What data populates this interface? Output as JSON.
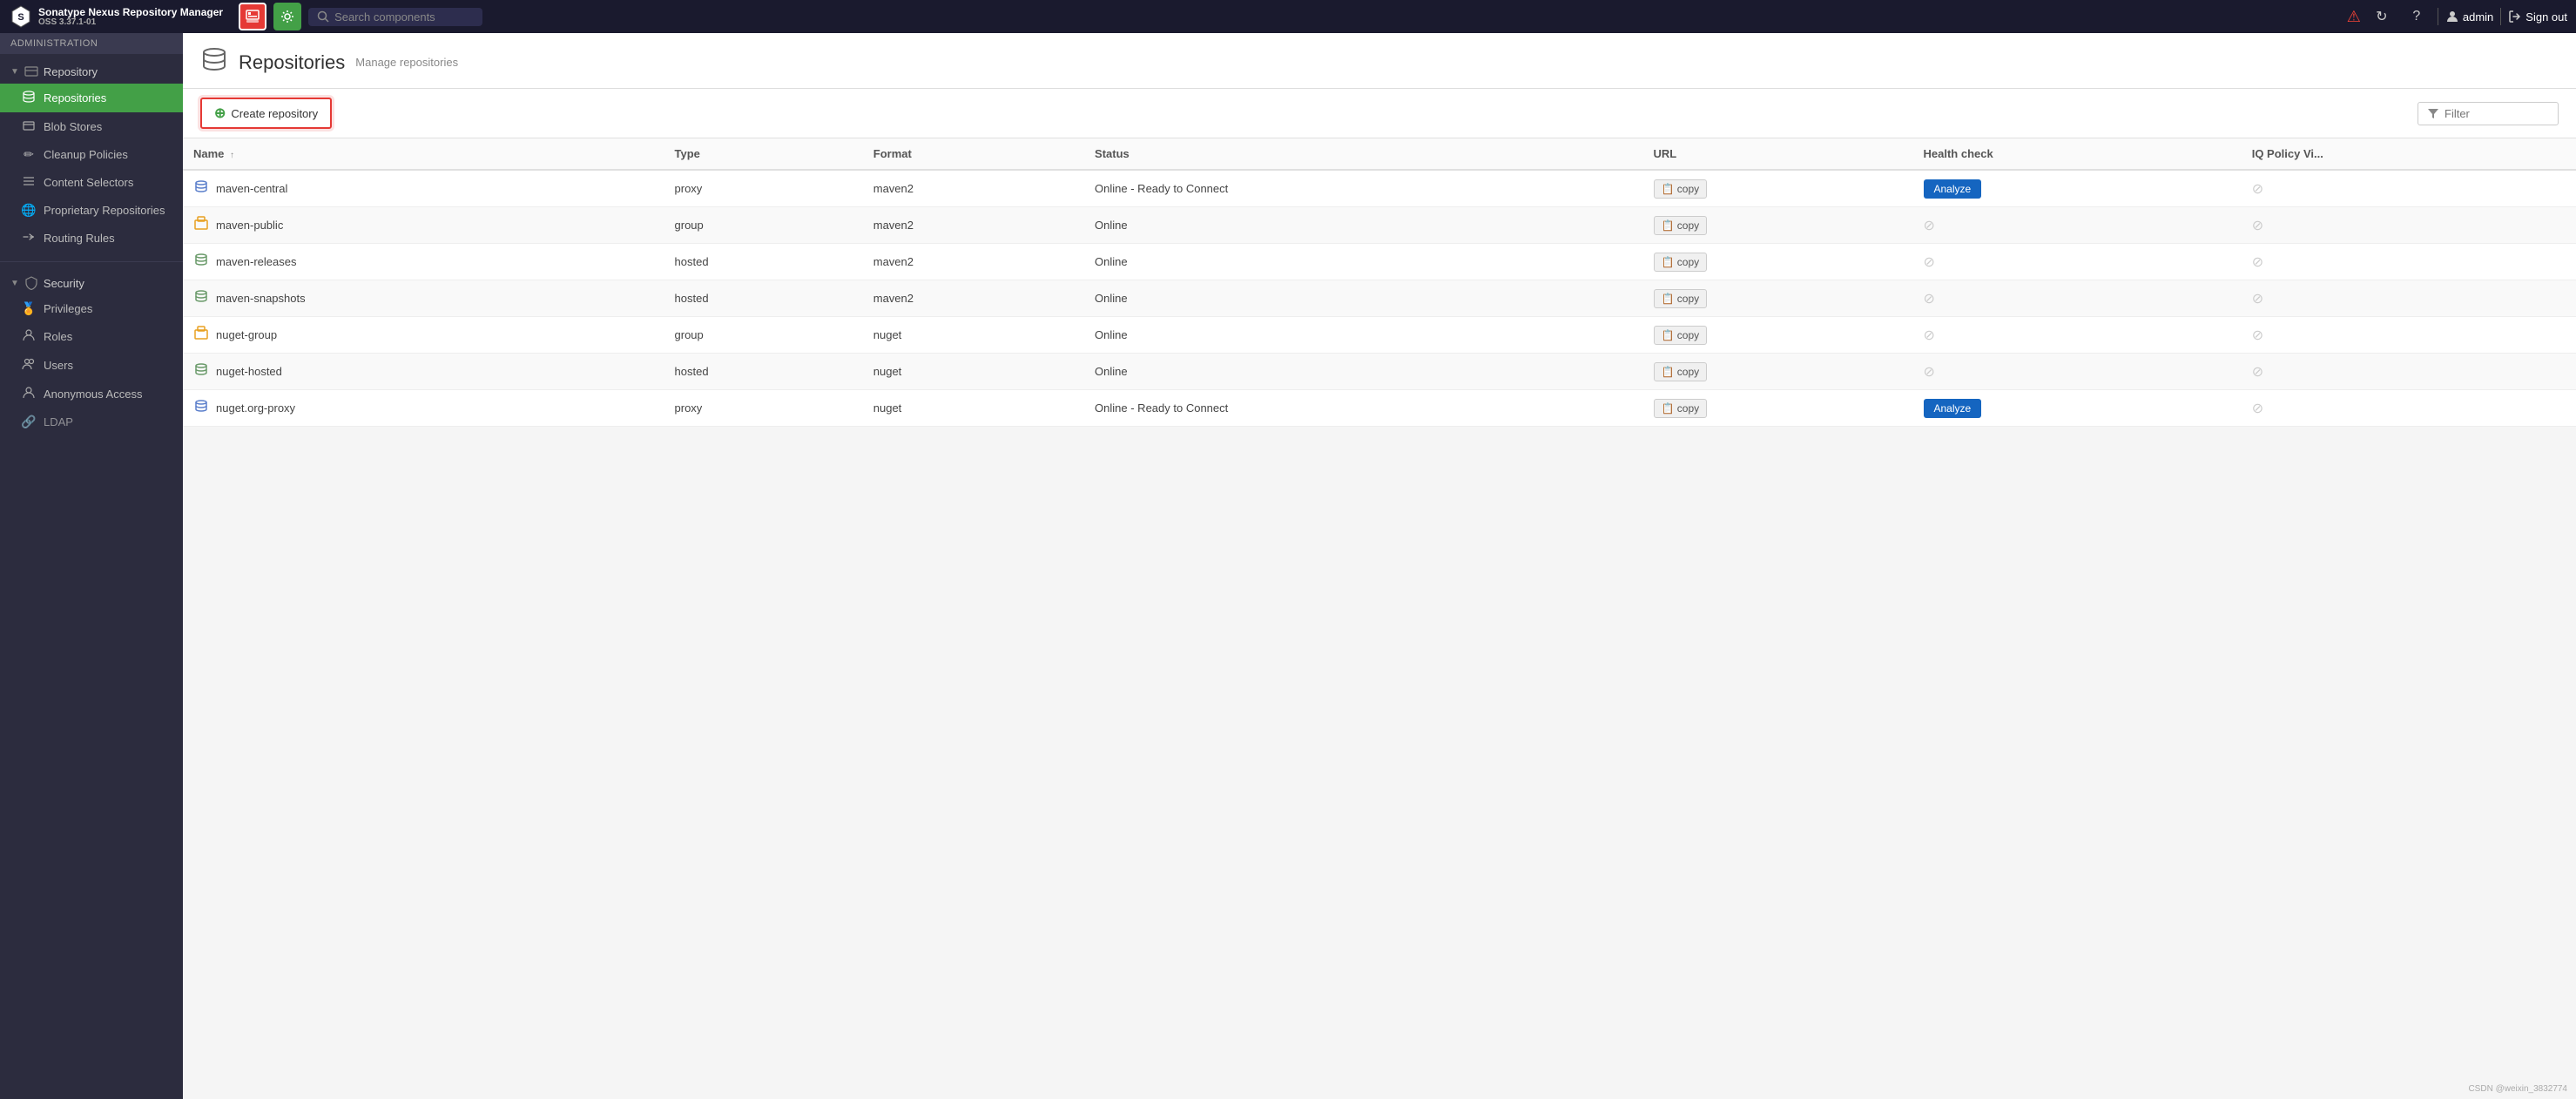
{
  "app": {
    "name": "Sonatype Nexus Repository Manager",
    "version": "OSS 3.37.1-01"
  },
  "topnav": {
    "search_placeholder": "Search components",
    "username": "admin",
    "signout_label": "Sign out"
  },
  "sidebar": {
    "admin_label": "Administration",
    "groups": [
      {
        "id": "repository",
        "label": "Repository",
        "expanded": true,
        "items": [
          {
            "id": "repositories",
            "label": "Repositories",
            "icon": "🗃",
            "active": true
          },
          {
            "id": "blob-stores",
            "label": "Blob Stores",
            "icon": "💾",
            "active": false
          },
          {
            "id": "cleanup-policies",
            "label": "Cleanup Policies",
            "icon": "✏",
            "active": false
          },
          {
            "id": "content-selectors",
            "label": "Content Selectors",
            "icon": "☰",
            "active": false
          },
          {
            "id": "proprietary-repos",
            "label": "Proprietary Repositories",
            "icon": "🌐",
            "active": false
          },
          {
            "id": "routing-rules",
            "label": "Routing Rules",
            "icon": "⇄",
            "active": false
          }
        ]
      },
      {
        "id": "security",
        "label": "Security",
        "expanded": true,
        "items": [
          {
            "id": "privileges",
            "label": "Privileges",
            "icon": "🏅",
            "active": false
          },
          {
            "id": "roles",
            "label": "Roles",
            "icon": "👤",
            "active": false
          },
          {
            "id": "users",
            "label": "Users",
            "icon": "👥",
            "active": false
          },
          {
            "id": "anonymous-access",
            "label": "Anonymous Access",
            "icon": "👤",
            "active": false
          },
          {
            "id": "ldap",
            "label": "LDAP",
            "icon": "🔗",
            "active": false
          }
        ]
      }
    ]
  },
  "page": {
    "title": "Repositories",
    "subtitle": "Manage repositories",
    "create_button": "Create repository",
    "filter_placeholder": "Filter"
  },
  "table": {
    "columns": [
      "Name",
      "Type",
      "Format",
      "Status",
      "URL",
      "Health check",
      "IQ Policy Vi..."
    ],
    "name_sort": "↑",
    "rows": [
      {
        "id": 1,
        "name": "maven-central",
        "icon_type": "proxy",
        "type": "proxy",
        "format": "maven2",
        "status": "Online - Ready to Connect",
        "status_class": "status-online-proxy",
        "has_analyze": true,
        "alt": false
      },
      {
        "id": 2,
        "name": "maven-public",
        "icon_type": "group",
        "type": "group",
        "format": "maven2",
        "status": "Online",
        "status_class": "status-online",
        "has_analyze": false,
        "alt": true
      },
      {
        "id": 3,
        "name": "maven-releases",
        "icon_type": "hosted",
        "type": "hosted",
        "format": "maven2",
        "status": "Online",
        "status_class": "status-online",
        "has_analyze": false,
        "alt": false
      },
      {
        "id": 4,
        "name": "maven-snapshots",
        "icon_type": "hosted",
        "type": "hosted",
        "format": "maven2",
        "status": "Online",
        "status_class": "status-online",
        "has_analyze": false,
        "alt": true
      },
      {
        "id": 5,
        "name": "nuget-group",
        "icon_type": "group",
        "type": "group",
        "format": "nuget",
        "status": "Online",
        "status_class": "status-online",
        "has_analyze": false,
        "alt": false
      },
      {
        "id": 6,
        "name": "nuget-hosted",
        "icon_type": "hosted",
        "type": "hosted",
        "format": "nuget",
        "status": "Online",
        "status_class": "status-online",
        "has_analyze": false,
        "alt": true
      },
      {
        "id": 7,
        "name": "nuget.org-proxy",
        "icon_type": "proxy",
        "type": "proxy",
        "format": "nuget",
        "status": "Online - Ready to Connect",
        "status_class": "status-online-proxy",
        "has_analyze": true,
        "alt": false
      }
    ]
  },
  "labels": {
    "copy": "copy",
    "analyze": "Analyze",
    "disabled_symbol": "⊘"
  },
  "watermark": "CSDN @weixin_3832774"
}
